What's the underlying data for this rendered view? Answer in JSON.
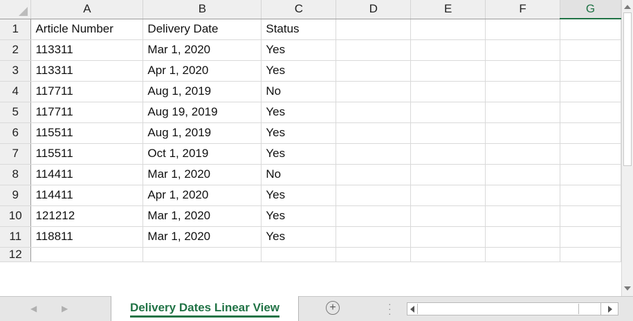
{
  "columns": [
    "A",
    "B",
    "C",
    "D",
    "E",
    "F",
    "G"
  ],
  "rows": [
    {
      "num": "1",
      "a": "Article Number",
      "b": "Delivery Date",
      "c": "Status"
    },
    {
      "num": "2",
      "a": "113311",
      "b": "Mar 1, 2020",
      "c": "Yes"
    },
    {
      "num": "3",
      "a": "113311",
      "b": "Apr 1, 2020",
      "c": "Yes"
    },
    {
      "num": "4",
      "a": "117711",
      "b": "Aug 1, 2019",
      "c": "No"
    },
    {
      "num": "5",
      "a": "117711",
      "b": "Aug 19, 2019",
      "c": "Yes"
    },
    {
      "num": "6",
      "a": "115511",
      "b": "Aug 1, 2019",
      "c": "Yes"
    },
    {
      "num": "7",
      "a": "115511",
      "b": "Oct 1, 2019",
      "c": "Yes"
    },
    {
      "num": "8",
      "a": "114411",
      "b": "Mar 1, 2020",
      "c": "No"
    },
    {
      "num": "9",
      "a": "114411",
      "b": "Apr 1, 2020",
      "c": "Yes"
    },
    {
      "num": "10",
      "a": "121212",
      "b": "Mar 1, 2020",
      "c": "Yes"
    },
    {
      "num": "11",
      "a": "118811",
      "b": "Mar 1, 2020",
      "c": "Yes"
    },
    {
      "num": "12",
      "a": "",
      "b": "",
      "c": ""
    }
  ],
  "selected_column": "G",
  "sheet_tab": {
    "label": "Delivery Dates Linear View"
  },
  "add_sheet_symbol": "+",
  "icons": {
    "corner": "select-all-triangle-icon",
    "nav_prev": "tab-prev-icon",
    "nav_next": "tab-next-icon",
    "add_sheet": "plus-circle-icon",
    "scroll_up": "arrow-up-icon",
    "scroll_down": "arrow-down-icon",
    "scroll_left": "arrow-left-icon",
    "scroll_right": "arrow-right-icon"
  },
  "colors": {
    "accent": "#217346",
    "header_bg": "#efefef",
    "gridline": "#d9d9d9"
  }
}
